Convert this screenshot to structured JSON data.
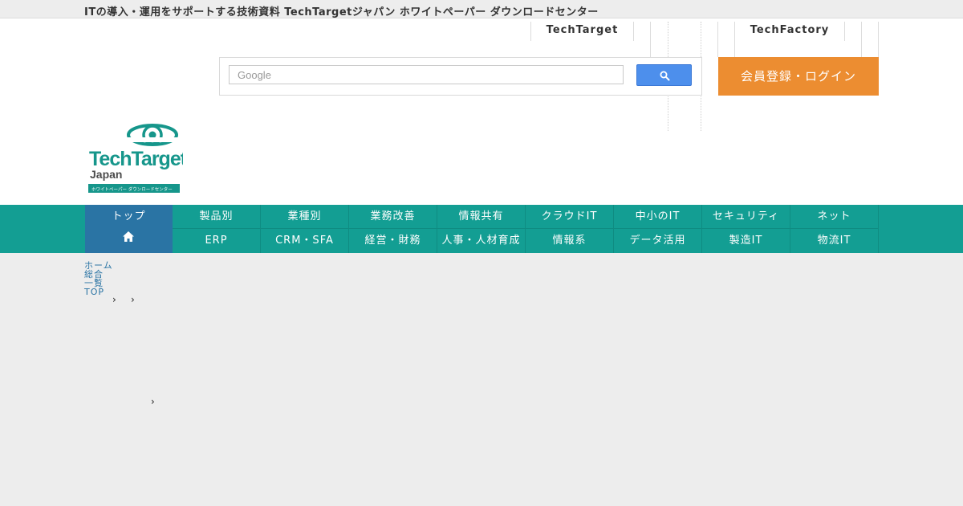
{
  "topbar": {
    "tagline": "ITの導入・運用をサポートする技術資料 TechTargetジャパン ホワイトペーパー ダウンロードセンター"
  },
  "header": {
    "links": [
      "TechTarget",
      "TechFactory"
    ],
    "search": {
      "placeholder": "Google"
    },
    "cta_button": "会員登録・ログイン",
    "logo": {
      "line1": "TechTarget",
      "line2": "Japan",
      "tagline": "ホワイトペーパー ダウンロードセンター"
    }
  },
  "nav": {
    "home": "トップ",
    "row1": [
      "製品別",
      "業種別",
      "業務改善",
      "情報共有",
      "クラウドIT",
      "中小のIT",
      "セキュリティ",
      "ネット"
    ],
    "row2": [
      "ERP",
      "CRM・SFA",
      "経営・財務",
      "人事・人材育成",
      "情報系",
      "データ活用",
      "製造IT",
      "物流IT"
    ]
  },
  "breadcrumb": {
    "items": [
      "ホーム",
      "総合",
      "一覧",
      "TOP"
    ]
  },
  "colors": {
    "nav_bg": "#139e93",
    "home_bg": "#2a74a4",
    "cta_bg": "#ec8d31",
    "search_btn": "#4d8fec"
  }
}
